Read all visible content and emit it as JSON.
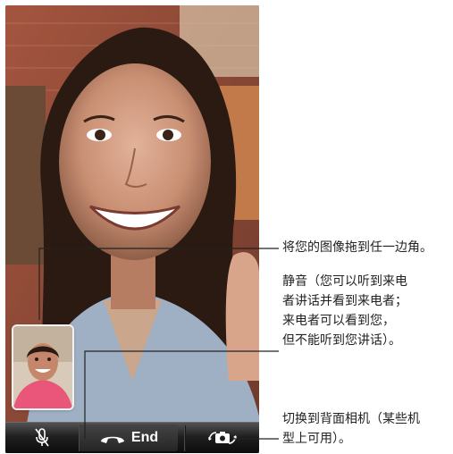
{
  "toolbar": {
    "mute_icon": "mic-muted-icon",
    "end_icon": "phone-handset-icon",
    "end_label": "End",
    "switch_icon": "camera-rotate-icon"
  },
  "callouts": {
    "drag": "将您的图像拖到任一边角。",
    "mute": [
      "静音（您可以听到来电",
      "者讲话并看到来电者；",
      "来电者可以看到您，",
      "但不能听到您讲话）。"
    ],
    "switch": [
      "切换到背面相机（某些机",
      "型上可用）。"
    ]
  },
  "colors": {
    "toolbar_bg": "#1f1f1f",
    "end_text": "#ffffff",
    "leader_line": "#222222"
  }
}
